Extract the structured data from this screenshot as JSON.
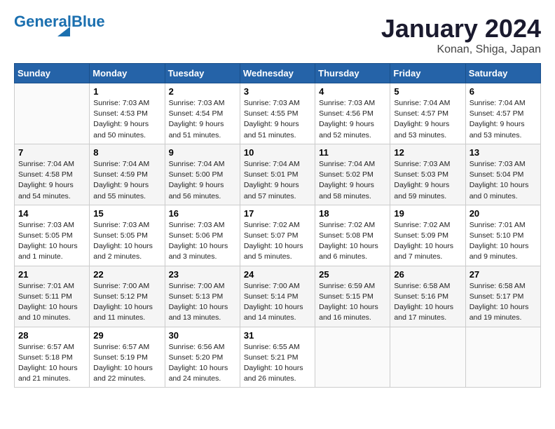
{
  "logo": {
    "part1": "General",
    "part2": "Blue"
  },
  "title": "January 2024",
  "location": "Konan, Shiga, Japan",
  "days_of_week": [
    "Sunday",
    "Monday",
    "Tuesday",
    "Wednesday",
    "Thursday",
    "Friday",
    "Saturday"
  ],
  "weeks": [
    [
      {
        "day": "",
        "content": ""
      },
      {
        "day": "1",
        "content": "Sunrise: 7:03 AM\nSunset: 4:53 PM\nDaylight: 9 hours\nand 50 minutes."
      },
      {
        "day": "2",
        "content": "Sunrise: 7:03 AM\nSunset: 4:54 PM\nDaylight: 9 hours\nand 51 minutes."
      },
      {
        "day": "3",
        "content": "Sunrise: 7:03 AM\nSunset: 4:55 PM\nDaylight: 9 hours\nand 51 minutes."
      },
      {
        "day": "4",
        "content": "Sunrise: 7:03 AM\nSunset: 4:56 PM\nDaylight: 9 hours\nand 52 minutes."
      },
      {
        "day": "5",
        "content": "Sunrise: 7:04 AM\nSunset: 4:57 PM\nDaylight: 9 hours\nand 53 minutes."
      },
      {
        "day": "6",
        "content": "Sunrise: 7:04 AM\nSunset: 4:57 PM\nDaylight: 9 hours\nand 53 minutes."
      }
    ],
    [
      {
        "day": "7",
        "content": "Sunrise: 7:04 AM\nSunset: 4:58 PM\nDaylight: 9 hours\nand 54 minutes."
      },
      {
        "day": "8",
        "content": "Sunrise: 7:04 AM\nSunset: 4:59 PM\nDaylight: 9 hours\nand 55 minutes."
      },
      {
        "day": "9",
        "content": "Sunrise: 7:04 AM\nSunset: 5:00 PM\nDaylight: 9 hours\nand 56 minutes."
      },
      {
        "day": "10",
        "content": "Sunrise: 7:04 AM\nSunset: 5:01 PM\nDaylight: 9 hours\nand 57 minutes."
      },
      {
        "day": "11",
        "content": "Sunrise: 7:04 AM\nSunset: 5:02 PM\nDaylight: 9 hours\nand 58 minutes."
      },
      {
        "day": "12",
        "content": "Sunrise: 7:03 AM\nSunset: 5:03 PM\nDaylight: 9 hours\nand 59 minutes."
      },
      {
        "day": "13",
        "content": "Sunrise: 7:03 AM\nSunset: 5:04 PM\nDaylight: 10 hours\nand 0 minutes."
      }
    ],
    [
      {
        "day": "14",
        "content": "Sunrise: 7:03 AM\nSunset: 5:05 PM\nDaylight: 10 hours\nand 1 minute."
      },
      {
        "day": "15",
        "content": "Sunrise: 7:03 AM\nSunset: 5:05 PM\nDaylight: 10 hours\nand 2 minutes."
      },
      {
        "day": "16",
        "content": "Sunrise: 7:03 AM\nSunset: 5:06 PM\nDaylight: 10 hours\nand 3 minutes."
      },
      {
        "day": "17",
        "content": "Sunrise: 7:02 AM\nSunset: 5:07 PM\nDaylight: 10 hours\nand 5 minutes."
      },
      {
        "day": "18",
        "content": "Sunrise: 7:02 AM\nSunset: 5:08 PM\nDaylight: 10 hours\nand 6 minutes."
      },
      {
        "day": "19",
        "content": "Sunrise: 7:02 AM\nSunset: 5:09 PM\nDaylight: 10 hours\nand 7 minutes."
      },
      {
        "day": "20",
        "content": "Sunrise: 7:01 AM\nSunset: 5:10 PM\nDaylight: 10 hours\nand 9 minutes."
      }
    ],
    [
      {
        "day": "21",
        "content": "Sunrise: 7:01 AM\nSunset: 5:11 PM\nDaylight: 10 hours\nand 10 minutes."
      },
      {
        "day": "22",
        "content": "Sunrise: 7:00 AM\nSunset: 5:12 PM\nDaylight: 10 hours\nand 11 minutes."
      },
      {
        "day": "23",
        "content": "Sunrise: 7:00 AM\nSunset: 5:13 PM\nDaylight: 10 hours\nand 13 minutes."
      },
      {
        "day": "24",
        "content": "Sunrise: 7:00 AM\nSunset: 5:14 PM\nDaylight: 10 hours\nand 14 minutes."
      },
      {
        "day": "25",
        "content": "Sunrise: 6:59 AM\nSunset: 5:15 PM\nDaylight: 10 hours\nand 16 minutes."
      },
      {
        "day": "26",
        "content": "Sunrise: 6:58 AM\nSunset: 5:16 PM\nDaylight: 10 hours\nand 17 minutes."
      },
      {
        "day": "27",
        "content": "Sunrise: 6:58 AM\nSunset: 5:17 PM\nDaylight: 10 hours\nand 19 minutes."
      }
    ],
    [
      {
        "day": "28",
        "content": "Sunrise: 6:57 AM\nSunset: 5:18 PM\nDaylight: 10 hours\nand 21 minutes."
      },
      {
        "day": "29",
        "content": "Sunrise: 6:57 AM\nSunset: 5:19 PM\nDaylight: 10 hours\nand 22 minutes."
      },
      {
        "day": "30",
        "content": "Sunrise: 6:56 AM\nSunset: 5:20 PM\nDaylight: 10 hours\nand 24 minutes."
      },
      {
        "day": "31",
        "content": "Sunrise: 6:55 AM\nSunset: 5:21 PM\nDaylight: 10 hours\nand 26 minutes."
      },
      {
        "day": "",
        "content": ""
      },
      {
        "day": "",
        "content": ""
      },
      {
        "day": "",
        "content": ""
      }
    ]
  ]
}
